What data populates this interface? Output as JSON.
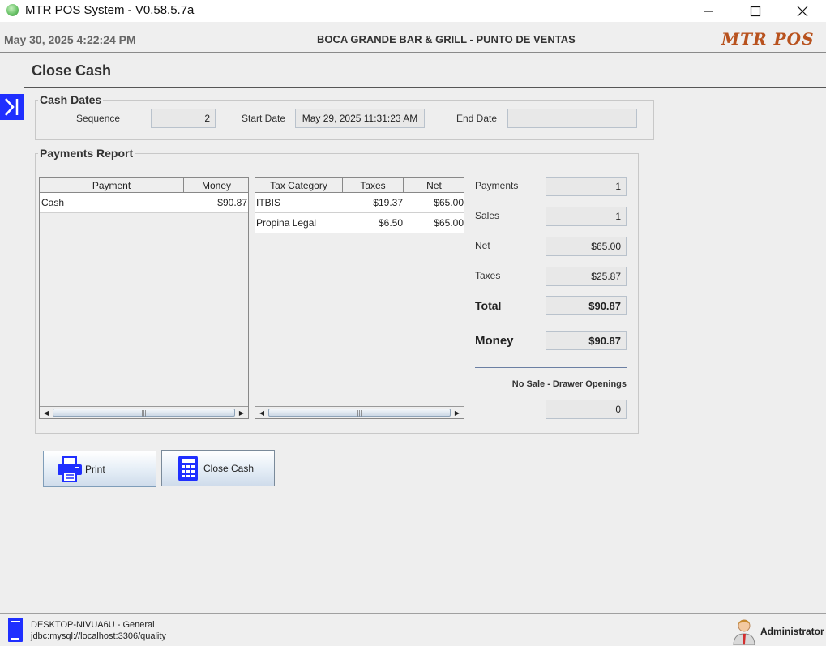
{
  "window": {
    "title": "MTR POS System - V0.58.5.7a"
  },
  "header": {
    "datetime": "May 30, 2025  4:22:24 PM",
    "store_name": "BOCA GRANDE BAR & GRILL - PUNTO DE VENTAS",
    "logo_text": "MTR POS"
  },
  "page": {
    "title": "Close Cash"
  },
  "cash_dates": {
    "title": "Cash Dates",
    "sequence_label": "Sequence",
    "sequence_value": "2",
    "start_date_label": "Start Date",
    "start_date_value": "May 29, 2025 11:31:23 AM",
    "end_date_label": "End Date",
    "end_date_value": ""
  },
  "payments_report": {
    "title": "Payments Report",
    "payments_table": {
      "columns": [
        "Payment",
        "Money"
      ],
      "rows": [
        {
          "payment": "Cash",
          "money": "$90.87"
        }
      ]
    },
    "taxes_table": {
      "columns": [
        "Tax Category",
        "Taxes",
        "Net"
      ],
      "rows": [
        {
          "category": "ITBIS",
          "taxes": "$19.37",
          "net": "$65.00"
        },
        {
          "category": "Propina Legal",
          "taxes": "$6.50",
          "net": "$65.00"
        }
      ]
    },
    "summary": {
      "payments_label": "Payments",
      "payments_value": "1",
      "sales_label": "Sales",
      "sales_value": "1",
      "net_label": "Net",
      "net_value": "$65.00",
      "taxes_label": "Taxes",
      "taxes_value": "$25.87",
      "total_label": "Total",
      "total_value": "$90.87",
      "money_label": "Money",
      "money_value": "$90.87",
      "no_sale_label": "No Sale - Drawer Openings",
      "no_sale_value": "0"
    }
  },
  "buttons": {
    "print": "Print",
    "close_cash": "Close Cash"
  },
  "status": {
    "host": "DESKTOP-NIVUA6U - General",
    "db": "jdbc:mysql://localhost:3306/quality",
    "user": "Administrator"
  },
  "colors": {
    "accent_blue": "#1f2fff",
    "logo": "#b8521e"
  }
}
